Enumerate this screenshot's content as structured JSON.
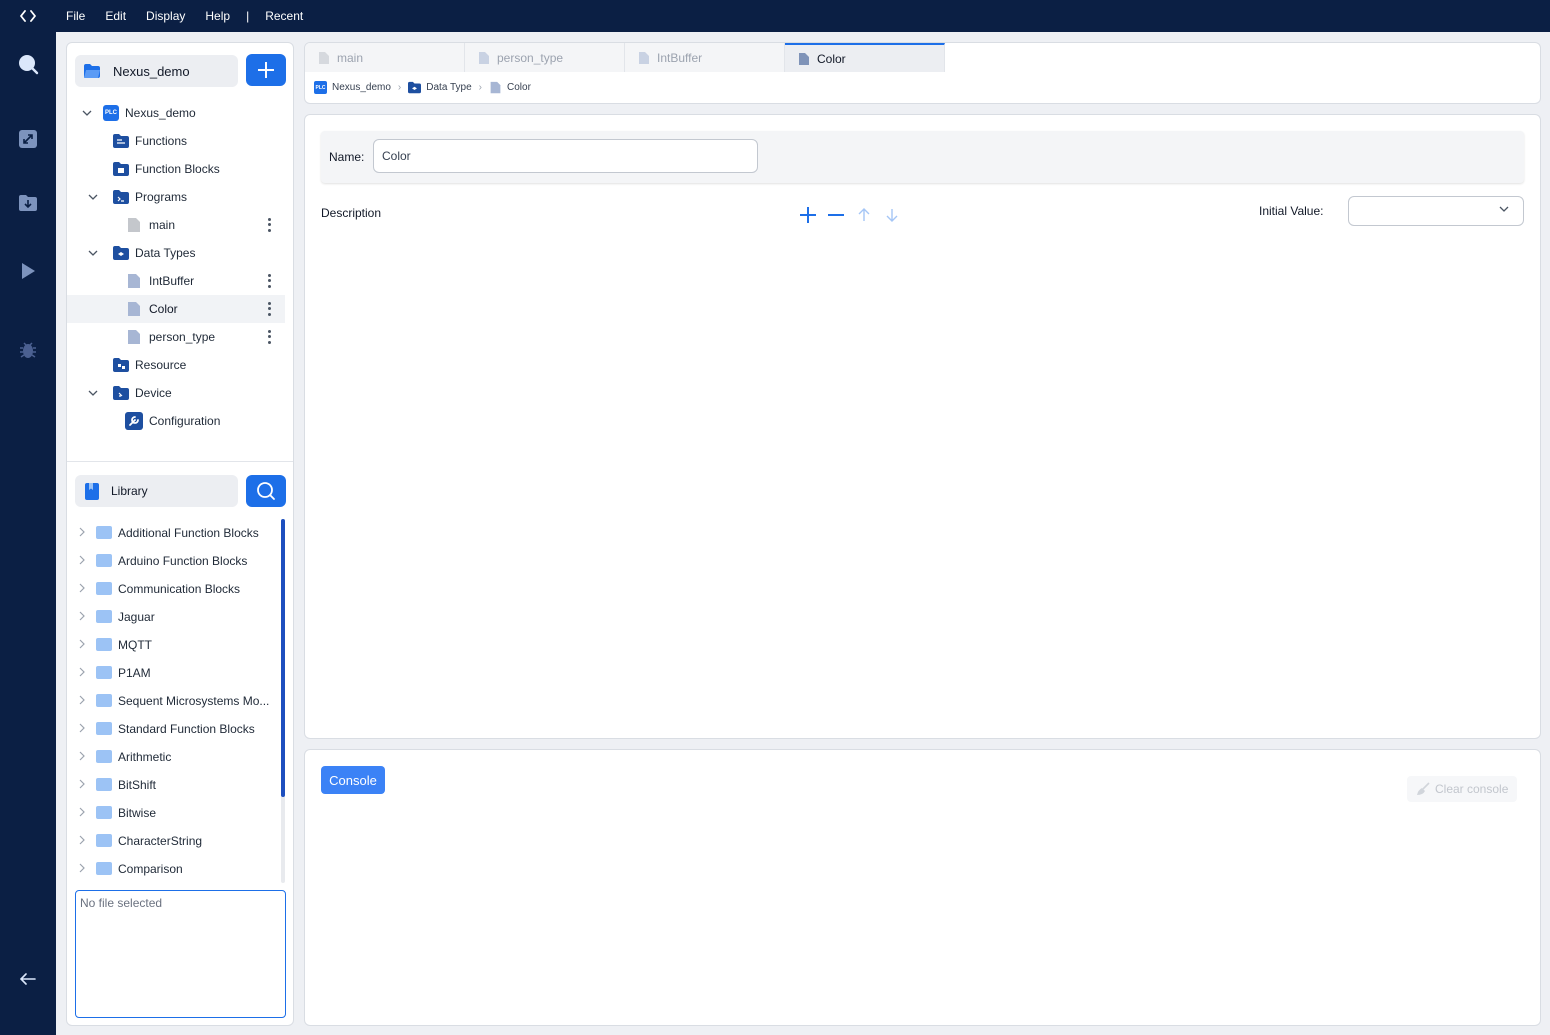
{
  "menu": {
    "file": "File",
    "edit": "Edit",
    "display": "Display",
    "help": "Help",
    "separator": "|",
    "recent": "Recent"
  },
  "project": {
    "name": "Nexus_demo",
    "tree": {
      "root": {
        "label": "Nexus_demo",
        "badge": "PLC"
      },
      "functions": "Functions",
      "function_blocks": "Function Blocks",
      "programs": "Programs",
      "main": "main",
      "data_types": "Data Types",
      "intbuffer": "IntBuffer",
      "color": "Color",
      "person_type": "person_type",
      "resource": "Resource",
      "device": "Device",
      "configuration": "Configuration"
    }
  },
  "library": {
    "title": "Library",
    "items": [
      "Additional Function Blocks",
      "Arduino Function Blocks",
      "Communication Blocks",
      "Jaguar",
      "MQTT",
      "P1AM",
      "Sequent Microsystems Mo...",
      "Standard Function Blocks",
      "Arithmetic",
      "BitShift",
      "Bitwise",
      "CharacterString",
      "Comparison"
    ],
    "file_placeholder": "No file selected"
  },
  "tabs": [
    "main",
    "person_type",
    "IntBuffer",
    "Color"
  ],
  "breadcrumb": {
    "project": "Nexus_demo",
    "project_badge": "PLC",
    "section": "Data Type",
    "item": "Color"
  },
  "editor": {
    "name_label": "Name:",
    "name_value": "Color",
    "description_label": "Description",
    "initial_value_label": "Initial Value:",
    "initial_value": ""
  },
  "console": {
    "tab_label": "Console",
    "clear_label": "Clear console"
  },
  "colors": {
    "navy": "#0b1f44",
    "accent": "#1d6fe8",
    "console": "#3b82f6"
  }
}
